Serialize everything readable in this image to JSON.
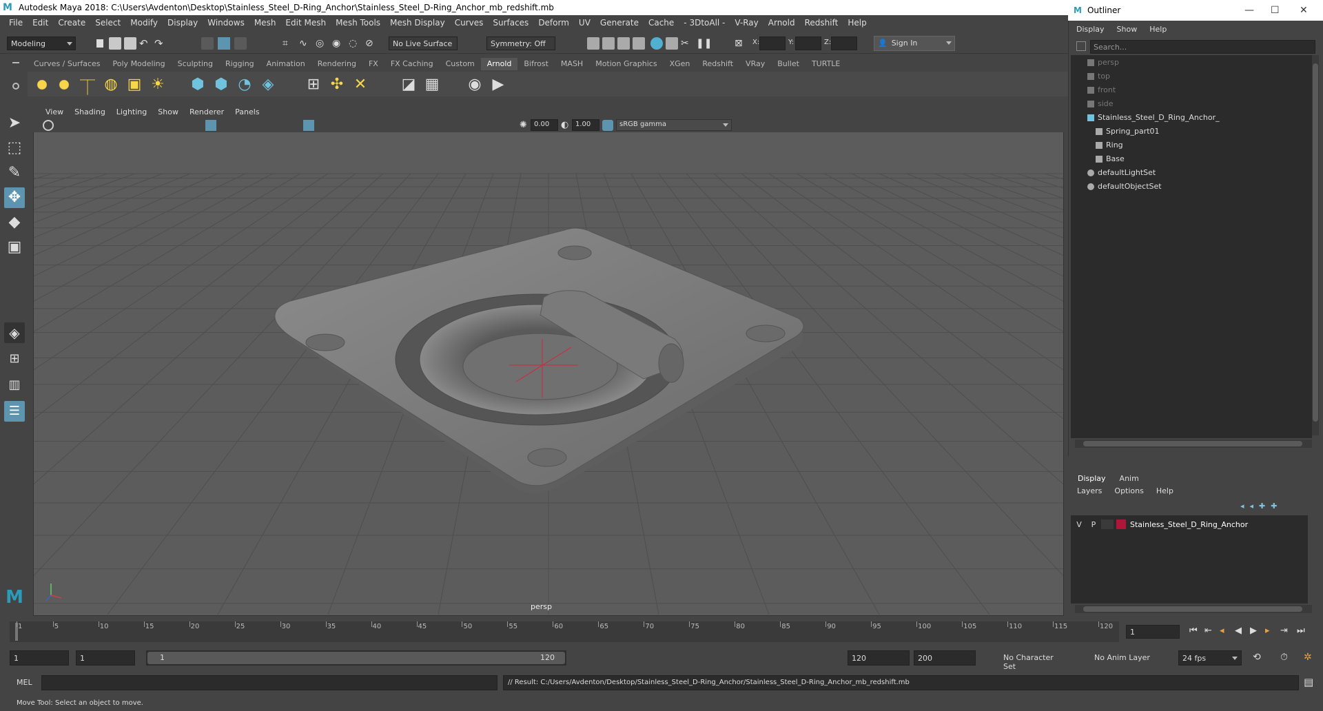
{
  "window": {
    "title": "Autodesk Maya 2018: C:\\Users\\Avdenton\\Desktop\\Stainless_Steel_D-Ring_Anchor\\Stainless_Steel_D-Ring_Anchor_mb_redshift.mb"
  },
  "menubar": [
    "File",
    "Edit",
    "Create",
    "Select",
    "Modify",
    "Display",
    "Windows",
    "Mesh",
    "Edit Mesh",
    "Mesh Tools",
    "Mesh Display",
    "Curves",
    "Surfaces",
    "Deform",
    "UV",
    "Generate",
    "Cache",
    "- 3DtoAll -",
    "V-Ray",
    "Arnold",
    "Redshift",
    "Help"
  ],
  "statusline": {
    "mode": "Modeling",
    "live_surface": "No Live Surface",
    "symmetry": "Symmetry: Off",
    "x_label": "X:",
    "y_label": "Y:",
    "z_label": "Z:",
    "sign_in": "Sign In"
  },
  "shelf": {
    "tabs": [
      "Curves / Surfaces",
      "Poly Modeling",
      "Sculpting",
      "Rigging",
      "Animation",
      "Rendering",
      "FX",
      "FX Caching",
      "Custom",
      "Arnold",
      "Bifrost",
      "MASH",
      "Motion Graphics",
      "XGen",
      "Redshift",
      "VRay",
      "Bullet",
      "TURTLE"
    ],
    "active_tab": "Arnold"
  },
  "viewport": {
    "menu": [
      "View",
      "Shading",
      "Lighting",
      "Show",
      "Renderer",
      "Panels"
    ],
    "exposure": "0.00",
    "gamma": "1.00",
    "color_space": "sRGB gamma",
    "camera": "persp"
  },
  "outliner": {
    "title": "Outliner",
    "menu": [
      "Display",
      "Show",
      "Help"
    ],
    "search_placeholder": "Search...",
    "items": [
      {
        "label": "persp",
        "dim": true,
        "indent": 0
      },
      {
        "label": "top",
        "dim": true,
        "indent": 0
      },
      {
        "label": "front",
        "dim": true,
        "indent": 0
      },
      {
        "label": "side",
        "dim": true,
        "indent": 0
      },
      {
        "label": "Stainless_Steel_D_Ring_Anchor_",
        "dim": false,
        "indent": 0
      },
      {
        "label": "Spring_part01",
        "dim": false,
        "indent": 1
      },
      {
        "label": "Ring",
        "dim": false,
        "indent": 1
      },
      {
        "label": "Base",
        "dim": false,
        "indent": 1
      },
      {
        "label": "defaultLightSet",
        "dim": false,
        "indent": 0
      },
      {
        "label": "defaultObjectSet",
        "dim": false,
        "indent": 0
      }
    ]
  },
  "layers": {
    "tabs": [
      "Display",
      "Anim"
    ],
    "menu": [
      "Layers",
      "Options",
      "Help"
    ],
    "row": {
      "v": "V",
      "p": "P",
      "name": "Stainless_Steel_D_Ring_Anchor",
      "color": "#b0163a"
    }
  },
  "timeline": {
    "ticks": [
      "1",
      "5",
      "10",
      "15",
      "20",
      "25",
      "30",
      "35",
      "40",
      "45",
      "50",
      "55",
      "60",
      "65",
      "70",
      "75",
      "80",
      "85",
      "90",
      "95",
      "100",
      "105",
      "110",
      "115",
      "120"
    ],
    "current_frame": "1"
  },
  "range": {
    "start": "1",
    "anim_start": "1",
    "slider_start": "1",
    "slider_end": "120",
    "playback_end": "120",
    "anim_end": "200",
    "character_set": "No Character Set",
    "anim_layer": "No Anim Layer",
    "fps": "24 fps"
  },
  "command": {
    "label": "MEL",
    "result": "// Result: C:/Users/Avdenton/Desktop/Stainless_Steel_D-Ring_Anchor/Stainless_Steel_D-Ring_Anchor_mb_redshift.mb"
  },
  "help_line": "Move Tool: Select an object to move."
}
